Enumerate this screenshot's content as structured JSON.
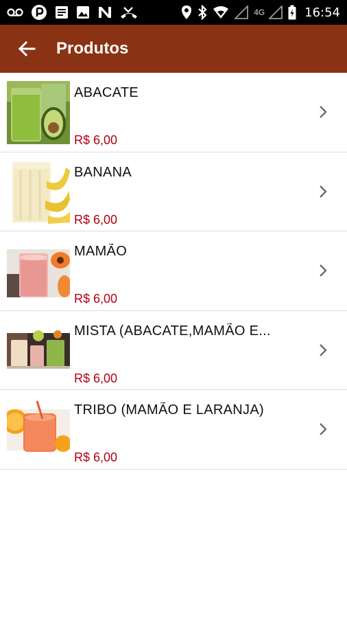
{
  "status_bar": {
    "time": "16:54",
    "network": "4G",
    "left_icons": [
      "voicemail-icon",
      "app-notification-icon",
      "message-icon",
      "image-icon",
      "n-app-icon",
      "missed-call-icon"
    ],
    "right_icons": [
      "location-icon",
      "bluetooth-icon",
      "wifi-icon",
      "signal-icon",
      "battery-icon"
    ]
  },
  "app_bar": {
    "title": "Produtos",
    "back_icon": "arrow-left-icon",
    "color": "#8a3214"
  },
  "colors": {
    "price": "#b00010",
    "divider": "#dcdcdc"
  },
  "products": [
    {
      "name": "ABACATE",
      "price": "R$ 6,00",
      "image": "avocado-smoothie"
    },
    {
      "name": "BANANA",
      "price": "R$ 6,00",
      "image": "banana-smoothie"
    },
    {
      "name": "MAMÃO",
      "price": "R$ 6,00",
      "image": "papaya-smoothie"
    },
    {
      "name": "MISTA (ABACATE,MAMÃO E...",
      "price": "R$ 6,00",
      "image": "mixed-smoothie"
    },
    {
      "name": "TRIBO (MAMÃO E LARANJA)",
      "price": "R$ 6,00",
      "image": "orange-papaya-juice"
    }
  ]
}
